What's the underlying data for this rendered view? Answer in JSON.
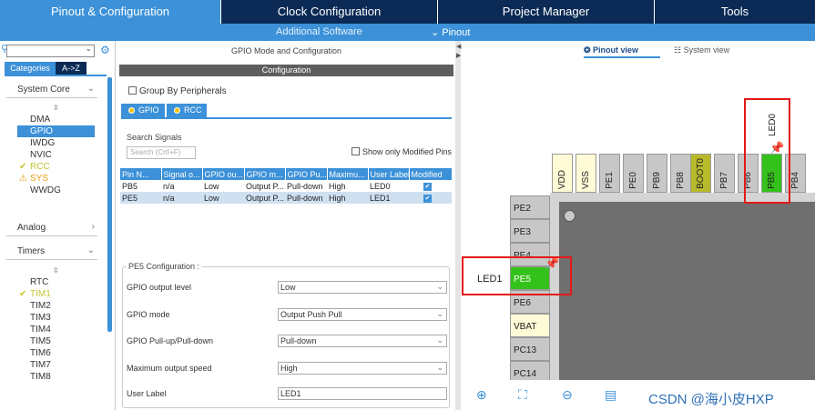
{
  "top_tabs": [
    "Pinout & Configuration",
    "Clock Configuration",
    "Project Manager",
    "Tools"
  ],
  "sub_bar": {
    "additional": "Additional Software",
    "pinout": "Pinout"
  },
  "left": {
    "tab_categories": "Categories",
    "tab_az": "A->Z",
    "system_core": {
      "label": "System Core",
      "items": [
        {
          "label": "DMA",
          "state": "normal"
        },
        {
          "label": "GPIO",
          "state": "selected"
        },
        {
          "label": "IWDG",
          "state": "normal"
        },
        {
          "label": "NVIC",
          "state": "normal"
        },
        {
          "label": "RCC",
          "state": "ok"
        },
        {
          "label": "SYS",
          "state": "warn"
        },
        {
          "label": "WWDG",
          "state": "normal"
        }
      ]
    },
    "analog": "Analog",
    "timers": {
      "label": "Timers",
      "items": [
        {
          "label": "RTC",
          "state": "normal"
        },
        {
          "label": "TIM1",
          "state": "ok"
        },
        {
          "label": "TIM2",
          "state": "normal"
        },
        {
          "label": "TIM3",
          "state": "normal"
        },
        {
          "label": "TIM4",
          "state": "normal"
        },
        {
          "label": "TIM5",
          "state": "normal"
        },
        {
          "label": "TIM6",
          "state": "normal"
        },
        {
          "label": "TIM7",
          "state": "normal"
        },
        {
          "label": "TIM8",
          "state": "normal"
        }
      ]
    }
  },
  "middle": {
    "title": "GPIO Mode and Configuration",
    "config_bar": "Configuration",
    "group_by": "Group By Peripherals",
    "tab_gpio": "GPIO",
    "tab_rcc": "RCC",
    "search_label": "Search Signals",
    "search_placeholder": "Search (CrtI+F)",
    "show_modified": "Show only Modified Pins",
    "table": {
      "headers": [
        "Pin N...",
        "Signal o...",
        "GPIO ou...",
        "GPIO m...",
        "GPIO Pu...",
        "Maximu...",
        "User Label",
        "Modified"
      ],
      "rows": [
        [
          "PB5",
          "n/a",
          "Low",
          "Output P...",
          "Pull-down",
          "High",
          "LED0"
        ],
        [
          "PE5",
          "n/a",
          "Low",
          "Output P...",
          "Pull-down",
          "High",
          "LED1"
        ]
      ]
    },
    "pe5": {
      "legend": "PE5 Configuration :",
      "fields": [
        {
          "label": "GPIO output level",
          "value": "Low"
        },
        {
          "label": "GPIO mode",
          "value": "Output Push Pull"
        },
        {
          "label": "GPIO Pull-up/Pull-down",
          "value": "Pull-down"
        },
        {
          "label": "Maximum output speed",
          "value": "High"
        },
        {
          "label": "User Label",
          "value": "LED1"
        }
      ]
    }
  },
  "right": {
    "pinout_view": "Pinout view",
    "system_view": "System view",
    "top_pins": [
      "VDD",
      "VSS",
      "PE1",
      "PE0",
      "PB9",
      "PB8",
      "BOOT0",
      "PB7",
      "PB6",
      "PB5",
      "PB4"
    ],
    "left_pins": [
      "PE2",
      "PE3",
      "PE4",
      "PE5",
      "PE6",
      "VBAT",
      "PC13",
      "PC14"
    ],
    "led0": "LED0",
    "led1": "LED1",
    "watermark": "CSDN @海小皮HXP",
    "colors": {
      "pin_yellow": "#fffbd6",
      "pin_gray": "#c7c7c7",
      "pin_green": "#35c11b",
      "boot_olive": "#b9b92c",
      "accent": "#3c91d8",
      "nav_dark": "#0b2a55"
    }
  }
}
